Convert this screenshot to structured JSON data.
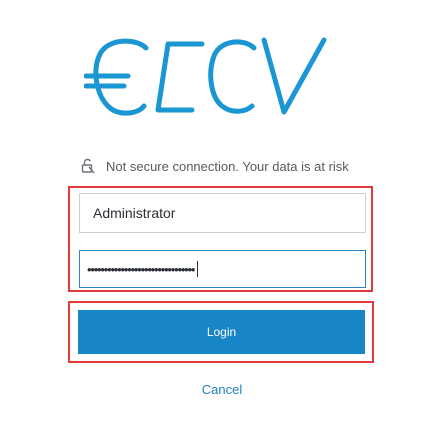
{
  "brand": {
    "logo_alt": "CCV",
    "color": "#1a96d2"
  },
  "security": {
    "icon": "broken-lock-icon",
    "text": "Not secure connection. Your data is at risk"
  },
  "login_form": {
    "username_value": "Administrator",
    "password_mask": "••••••••••••••••••••••••••••••••",
    "login_label": "Login",
    "cancel_label": "Cancel"
  },
  "colors": {
    "accent": "#1785c6",
    "highlight_border": "#e03a3a",
    "link": "#1f7fbf"
  }
}
